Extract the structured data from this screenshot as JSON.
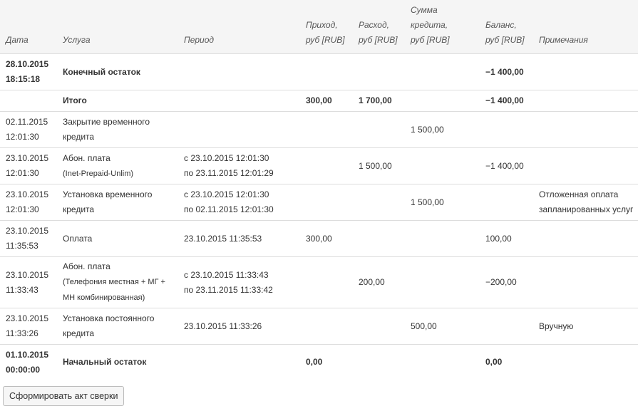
{
  "headers": {
    "date": "Дата",
    "service": "Услуга",
    "period": "Период",
    "income": [
      "Приход,",
      "руб [RUB]"
    ],
    "expense": [
      "Расход,",
      "руб [RUB]"
    ],
    "credit": [
      "Сумма кредита,",
      "руб [RUB]"
    ],
    "balance": [
      "Баланс,",
      "руб [RUB]"
    ],
    "notes": "Примечания"
  },
  "rows": [
    {
      "date": [
        "28.10.2015",
        "18:15:18"
      ],
      "service": [
        "Конечный остаток"
      ],
      "period": [],
      "income": "",
      "expense": "",
      "credit": "",
      "balance": "−1 400,00",
      "notes": [],
      "bold": true
    },
    {
      "date": [],
      "service": [
        "Итого"
      ],
      "period": [],
      "income": "300,00",
      "expense": "1 700,00",
      "credit": "",
      "balance": "−1 400,00",
      "notes": [],
      "bold": true
    },
    {
      "date": [
        "02.11.2015",
        "12:01:30"
      ],
      "service": [
        "Закрытие временного",
        "кредита"
      ],
      "period": [],
      "income": "",
      "expense": "",
      "credit": "1 500,00",
      "balance": "",
      "notes": []
    },
    {
      "date": [
        "23.10.2015",
        "12:01:30"
      ],
      "service": [
        "Абон. плата"
      ],
      "service_sub": [
        "(Inet-Prepaid-Unlim)"
      ],
      "period": [
        "с 23.10.2015 12:01:30",
        "по 23.11.2015 12:01:29"
      ],
      "income": "",
      "expense": "1 500,00",
      "credit": "",
      "balance": "−1 400,00",
      "notes": []
    },
    {
      "date": [
        "23.10.2015",
        "12:01:30"
      ],
      "service": [
        "Установка временного",
        "кредита"
      ],
      "period": [
        "с 23.10.2015 12:01:30",
        "по 02.11.2015 12:01:30"
      ],
      "income": "",
      "expense": "",
      "credit": "1 500,00",
      "balance": "",
      "notes": [
        "Отложенная оплата",
        "запланированных услуг"
      ]
    },
    {
      "date": [
        "23.10.2015",
        "11:35:53"
      ],
      "service": [
        "Оплата"
      ],
      "period": [
        "23.10.2015 11:35:53"
      ],
      "income": "300,00",
      "expense": "",
      "credit": "",
      "balance": "100,00",
      "notes": []
    },
    {
      "date": [
        "23.10.2015",
        "11:33:43"
      ],
      "service": [
        "Абон. плата"
      ],
      "service_sub": [
        "(Телефония местная + МГ +",
        "МН комбинированная)"
      ],
      "period": [
        "с 23.10.2015 11:33:43",
        "по 23.11.2015 11:33:42"
      ],
      "income": "",
      "expense": "200,00",
      "credit": "",
      "balance": "−200,00",
      "notes": []
    },
    {
      "date": [
        "23.10.2015",
        "11:33:26"
      ],
      "service": [
        "Установка постоянного",
        "кредита"
      ],
      "period": [
        "23.10.2015 11:33:26"
      ],
      "income": "",
      "expense": "",
      "credit": "500,00",
      "balance": "",
      "notes": [
        "Вручную"
      ]
    },
    {
      "date": [
        "01.10.2015",
        "00:00:00"
      ],
      "service": [
        "Начальный остаток"
      ],
      "period": [],
      "income": "0,00",
      "expense": "",
      "credit": "",
      "balance": "0,00",
      "notes": [],
      "bold": true
    }
  ],
  "button_label": "Сформировать акт сверки"
}
